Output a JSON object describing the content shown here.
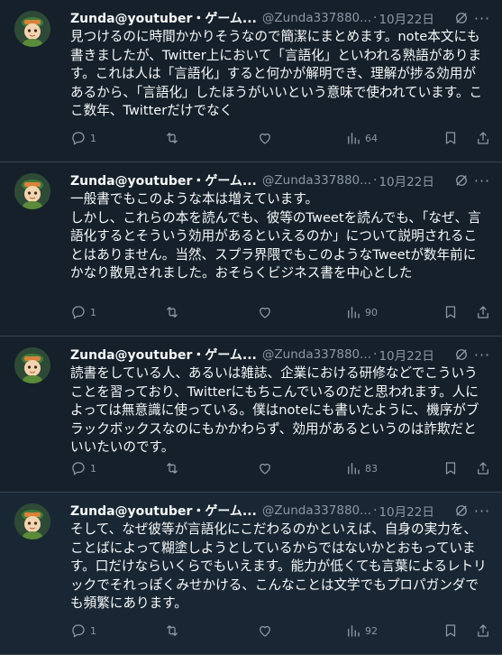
{
  "tweets": [
    {
      "name": "Zunda@youtuber・ゲーム...",
      "handle": "@Zunda337880...",
      "sep": "·",
      "date": "10月22日",
      "text": "見つけるのに時間かかりそうなので簡潔にまとめます。note本文にも書きましたが、Twitter上において「言語化」といわれる熟語があります。これは人は「言語化」すると何かが解明でき、理解が捗る効用があるから、「言語化」したほうがいいという意味で使われています。ここ数年、Twitterだけでなく",
      "replies": "1",
      "retweets": "",
      "likes": "",
      "views": "64"
    },
    {
      "name": "Zunda@youtuber・ゲーム...",
      "handle": "@Zunda337880...",
      "sep": "·",
      "date": "10月22日",
      "text": "一般書でもこのような本は増えています。\nしかし、これらの本を読んでも、彼等のTweetを読んでも、「なぜ、言語化するとそういう効用があるといえるのか」について説明されることはありません。当然、スプラ界隈でもこのようなTweetが数年前にかなり散見されました。おそらくビジネス書を中心とした",
      "replies": "1",
      "retweets": "",
      "likes": "",
      "views": "90"
    },
    {
      "name": "Zunda@youtuber・ゲーム...",
      "handle": "@Zunda337880...",
      "sep": "·",
      "date": "10月22日",
      "text": "読書をしている人、あるいは雑誌、企業における研修などでこういうことを習っており、Twitterにもちこんでいるのだと思われます。人によっては無意識に使っている。僕はnoteにも書いたように、機序がブラックボックスなのにもかかわらず、効用があるというのは詐欺だといいたいのです。",
      "replies": "1",
      "retweets": "",
      "likes": "",
      "views": "83"
    },
    {
      "name": "Zunda@youtuber・ゲーム...",
      "handle": "@Zunda337880...",
      "sep": "·",
      "date": "10月22日",
      "text": "そして、なぜ彼等が言語化にこだわるのかといえば、自身の実力を、ことばによって糊塗しようとしているからではないかとおもっています。口だけならいくらでもいえます。能力が低くても言葉によるレトリックでそれっぽくみせかける、こんなことは文学でもプロパガンダでも頻繁にあります。",
      "replies": "1",
      "retweets": "",
      "likes": "",
      "views": "92"
    }
  ],
  "colors": {
    "background": "#15202b",
    "thread_background": "#192734",
    "text": "#f7f9f9",
    "muted": "#8b98a5",
    "divider": "#38444d"
  },
  "icons": [
    "reply-icon",
    "retweet-icon",
    "like-icon",
    "views-icon",
    "bookmark-icon",
    "share-icon",
    "grok-icon",
    "more-icon"
  ]
}
